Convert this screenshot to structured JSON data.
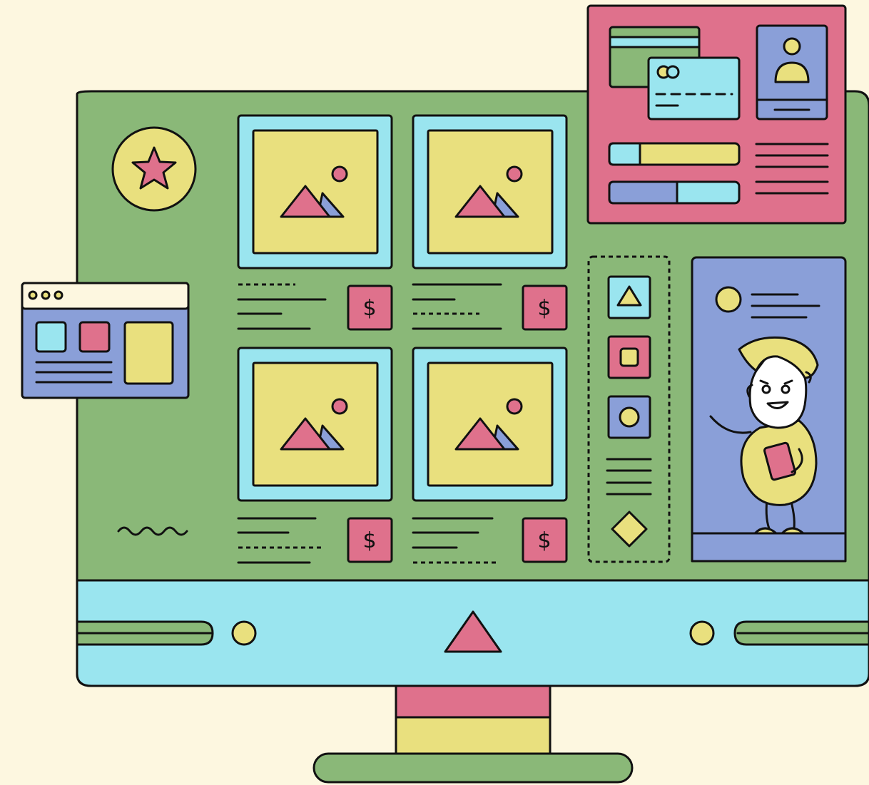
{
  "colors": {
    "background": "#fdf7e0",
    "green": "#8ab878",
    "cyan": "#9ae5ef",
    "yellow": "#e9e07e",
    "pink": "#df718c",
    "purple": "#8a9fd8",
    "outline": "#111111"
  },
  "gallery": {
    "products": [
      {
        "image_icon": "mountain-image-icon",
        "price_symbol": "$"
      },
      {
        "image_icon": "mountain-image-icon",
        "price_symbol": "$"
      },
      {
        "image_icon": "mountain-image-icon",
        "price_symbol": "$"
      },
      {
        "image_icon": "mountain-image-icon",
        "price_symbol": "$"
      }
    ]
  },
  "icons": {
    "favorite": "star-icon",
    "toolbox": [
      "triangle-icon",
      "square-icon",
      "circle-icon",
      "diamond-icon"
    ],
    "nav_center": "triangle-up-icon",
    "profile": "user-avatar-icon"
  }
}
